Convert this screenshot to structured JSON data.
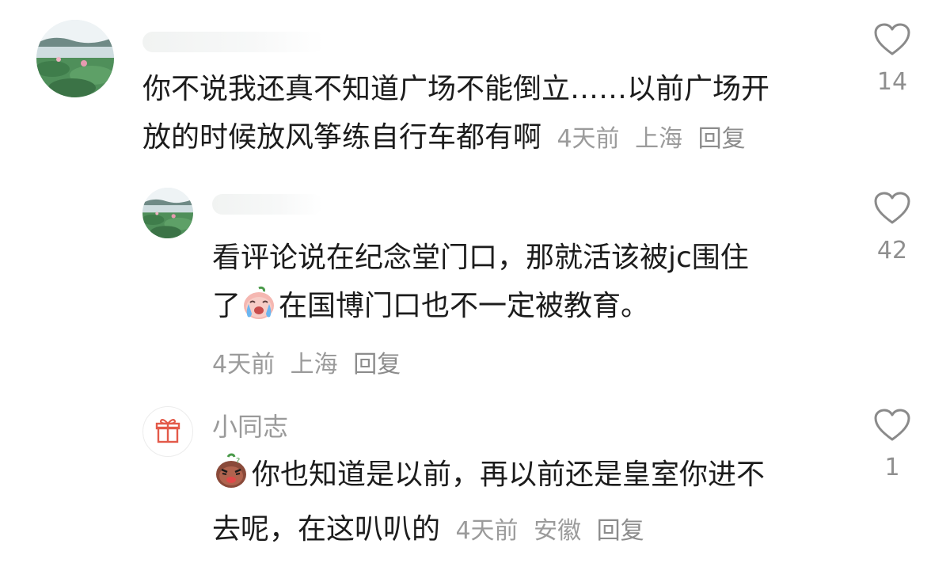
{
  "comments": [
    {
      "text_parts": [
        "你不说我还真不知道广场不能倒立……以前广场开",
        "放的时候放风筝练自行车都有啊"
      ],
      "time": "4天前",
      "location": "上海",
      "reply_label": "回复",
      "likes": "14",
      "avatar_icon": "lotus-pond-avatar"
    },
    {
      "text_line1": "看评论说在纪念堂门口，那就活该被jc围住",
      "text_line2_a": "了",
      "emoji": "crying-peach-emoji",
      "text_line2_b": "在国博门口也不一定被教育。",
      "time": "4天前",
      "location": "上海",
      "reply_label": "回复",
      "likes": "42",
      "avatar_icon": "lotus-pond-avatar"
    },
    {
      "username": "小同志",
      "emoji": "angry-bean-emoji",
      "text_line1": "你也知道是以前，再以前还是皇室你进不",
      "text_line2": "去呢，在这叭叭的",
      "time": "4天前",
      "location": "安徽",
      "reply_label": "回复",
      "likes": "1",
      "avatar_icon": "gift-icon"
    }
  ],
  "colors": {
    "text": "#1c1c1c",
    "meta": "#9b9b9b",
    "heart": "#8a8a8a"
  }
}
